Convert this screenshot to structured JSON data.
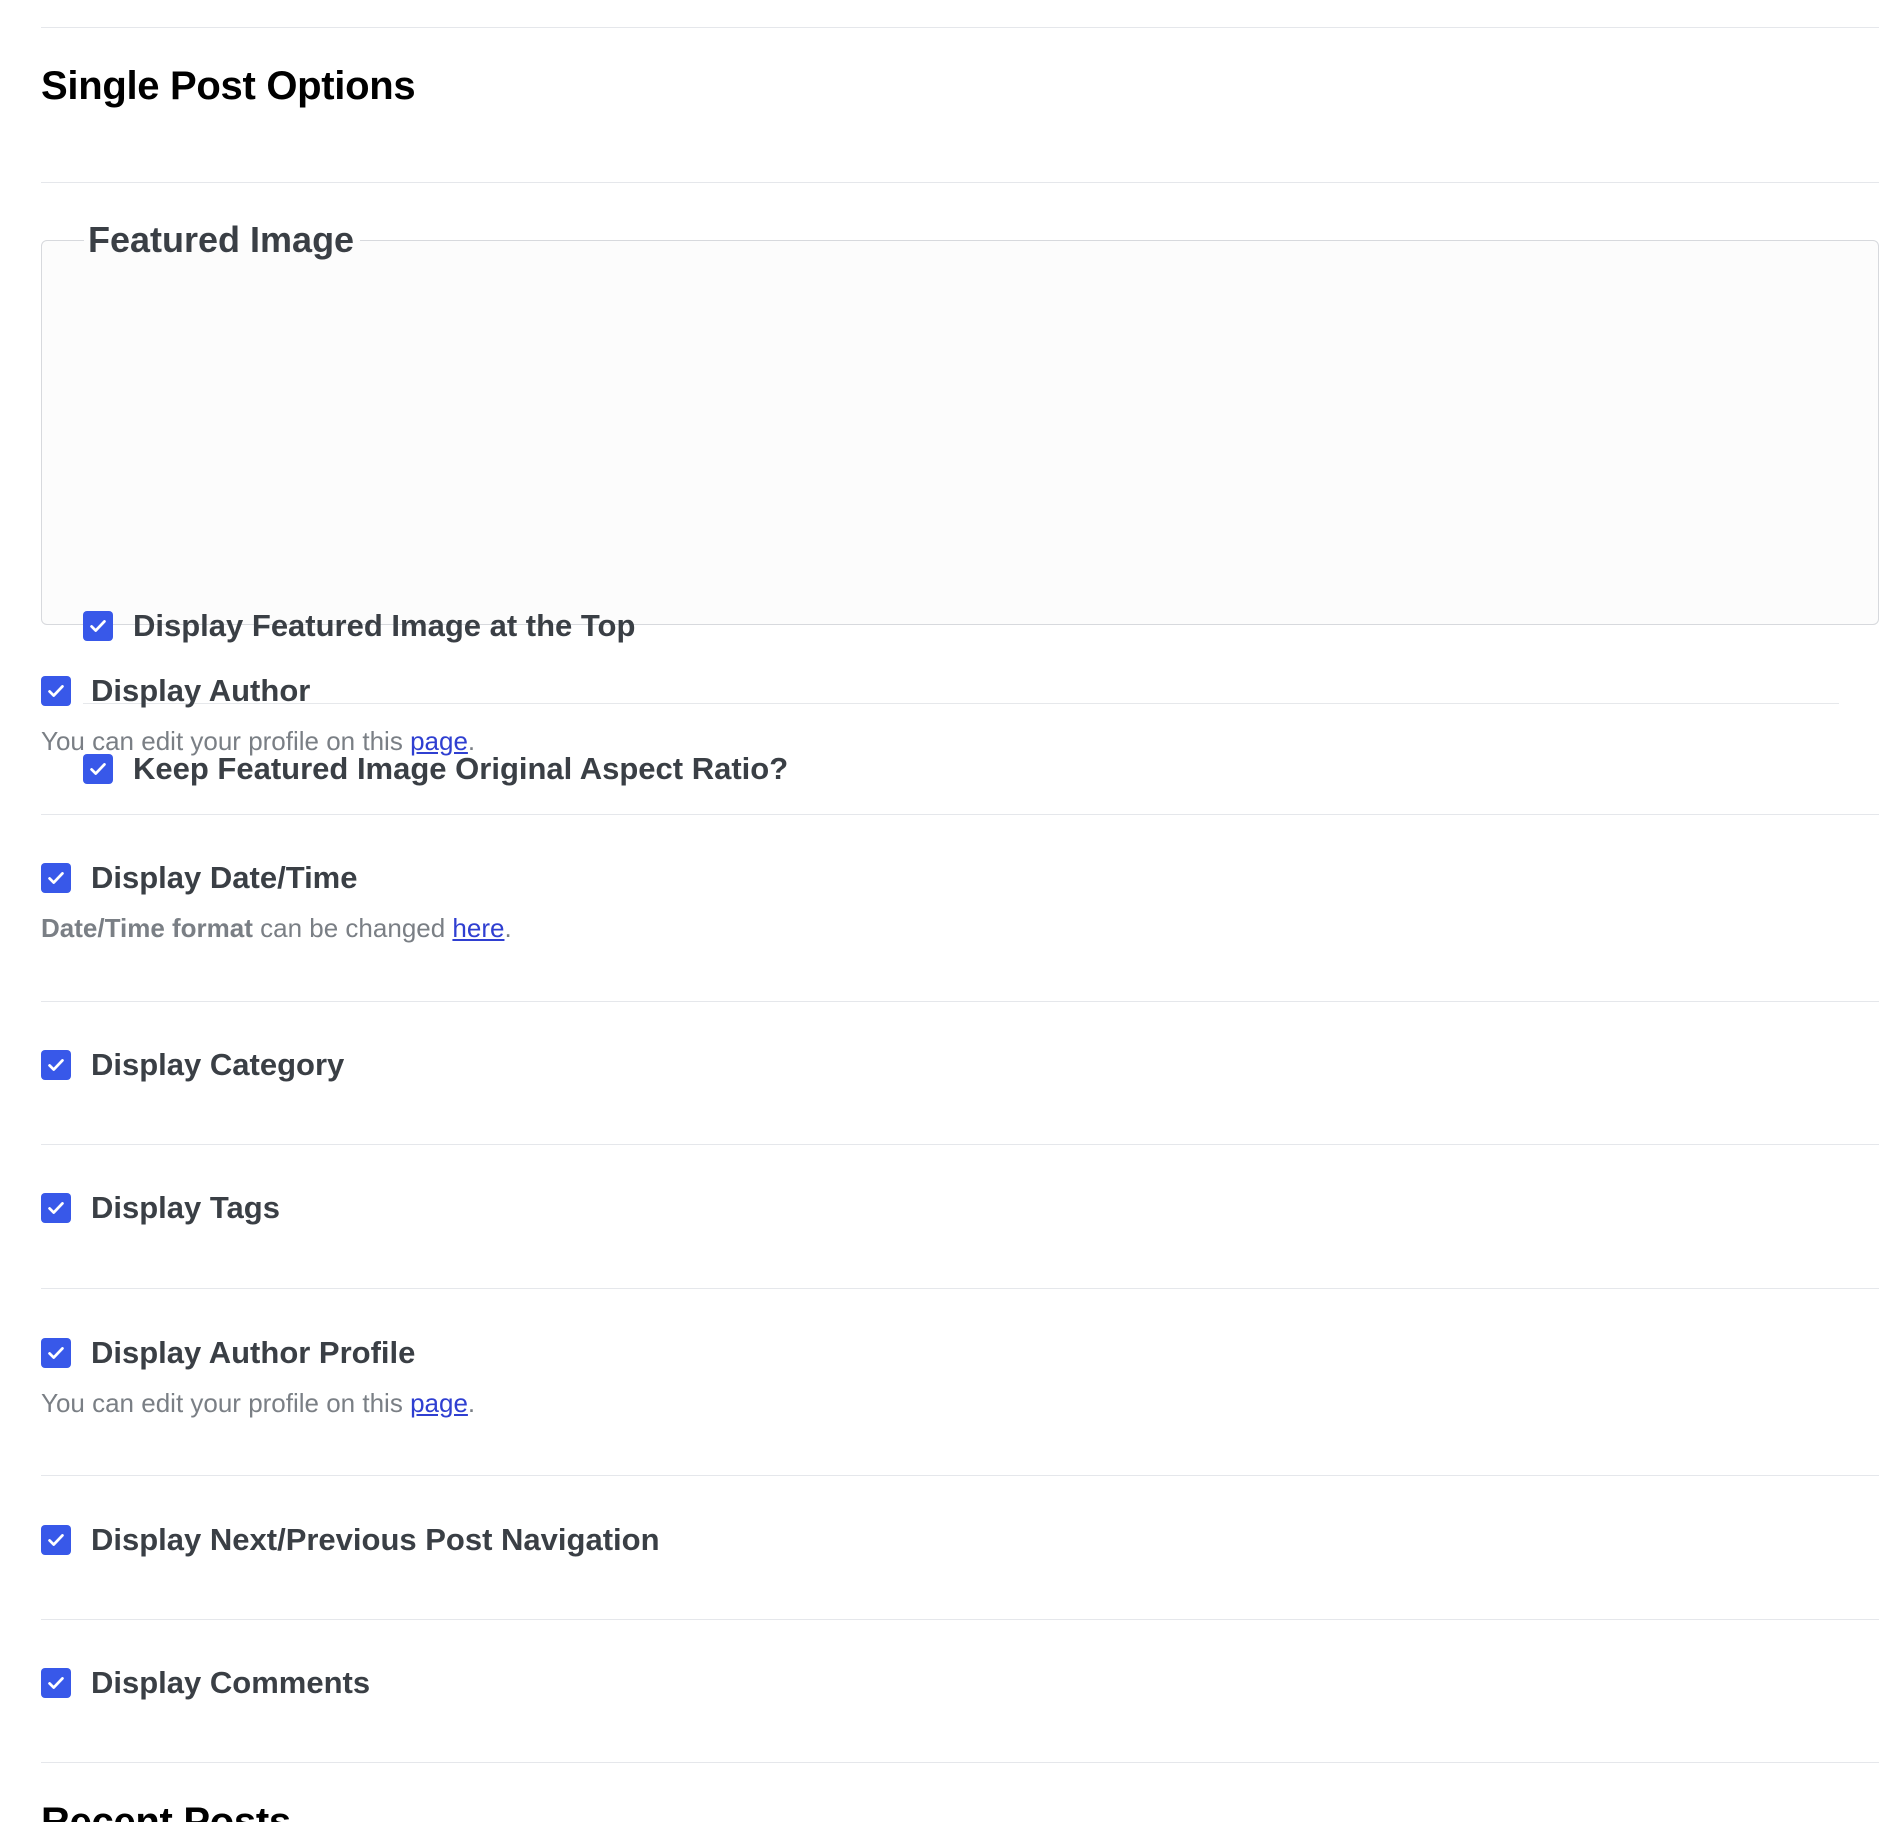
{
  "page": {
    "title": "Single Post Options",
    "next_section_title": "Recent Posts"
  },
  "featured_image": {
    "legend": "Featured Image",
    "options": [
      {
        "label": "Display Featured Image at the Top",
        "checked": true
      },
      {
        "label": "Keep Featured Image Original Aspect Ratio?",
        "checked": true
      }
    ]
  },
  "options": {
    "display_author": {
      "label": "Display Author",
      "checked": true,
      "help_prefix": "You can edit your profile on this ",
      "help_link": "page",
      "help_suffix": "."
    },
    "display_datetime": {
      "label": "Display Date/Time",
      "checked": true,
      "help_strong": "Date/Time format",
      "help_prefix": " can be changed ",
      "help_link": "here",
      "help_suffix": "."
    },
    "display_category": {
      "label": "Display Category",
      "checked": true
    },
    "display_tags": {
      "label": "Display Tags",
      "checked": true
    },
    "display_author_profile": {
      "label": "Display Author Profile",
      "checked": true,
      "help_prefix": "You can edit your profile on this ",
      "help_link": "page",
      "help_suffix": "."
    },
    "display_post_navigation": {
      "label": "Display Next/Previous Post Navigation",
      "checked": true
    },
    "display_comments": {
      "label": "Display Comments",
      "checked": true
    }
  },
  "colors": {
    "checkbox_accent": "#3858e9",
    "link": "#2f3fd1",
    "help_text": "#7a7f85",
    "label_text": "#3a3f45",
    "divider": "#e5e7eb"
  }
}
